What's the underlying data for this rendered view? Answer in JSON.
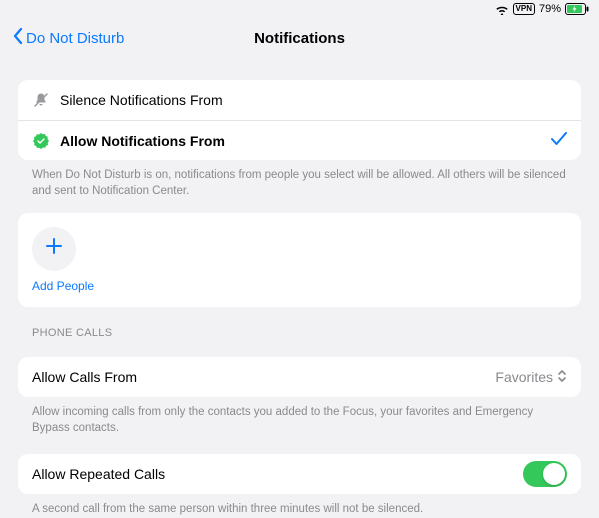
{
  "status": {
    "vpn": "VPN",
    "battery_pct": "79%"
  },
  "nav": {
    "back_label": "Do Not Disturb",
    "title": "Notifications"
  },
  "notif_options": {
    "silence_label": "Silence Notifications From",
    "allow_label": "Allow Notifications From",
    "footer": "When Do Not Disturb is on, notifications from people you select will be allowed. All others will be silenced and sent to Notification Center."
  },
  "add_people": {
    "label": "Add People"
  },
  "phone_calls": {
    "header": "PHONE CALLS",
    "allow_from_label": "Allow Calls From",
    "allow_from_value": "Favorites",
    "allow_from_footer": "Allow incoming calls from only the contacts you added to the Focus, your favorites and Emergency Bypass contacts.",
    "repeated_label": "Allow Repeated Calls",
    "repeated_footer": "A second call from the same person within three minutes will not be silenced."
  }
}
